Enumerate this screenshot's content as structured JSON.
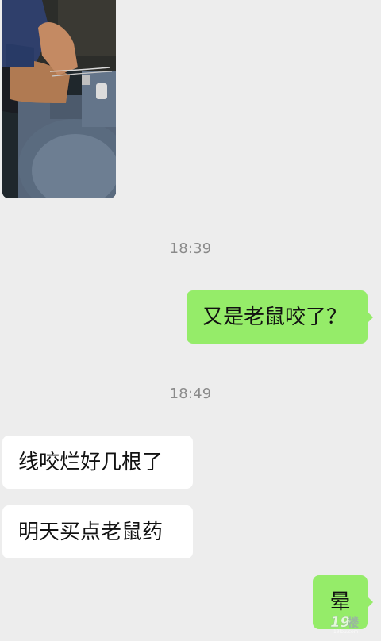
{
  "messages": [
    {
      "type": "image",
      "side": "left",
      "alt": "photo of hands repairing washing machine wires"
    },
    {
      "type": "timestamp",
      "text": "18:39"
    },
    {
      "type": "text",
      "side": "right",
      "text": "又是老鼠咬了？"
    },
    {
      "type": "timestamp",
      "text": "18:49"
    },
    {
      "type": "text",
      "side": "left",
      "text": "线咬烂好几根了"
    },
    {
      "type": "text",
      "side": "left",
      "text": "明天买点老鼠药"
    },
    {
      "type": "text",
      "side": "right",
      "text": "晕"
    }
  ],
  "watermark": {
    "mark": "19楼",
    "url": "19lou.com"
  },
  "colors": {
    "background": "#ededed",
    "outgoing_bubble": "#95ec69",
    "incoming_bubble": "#ffffff",
    "timestamp": "#8a8a8a"
  }
}
